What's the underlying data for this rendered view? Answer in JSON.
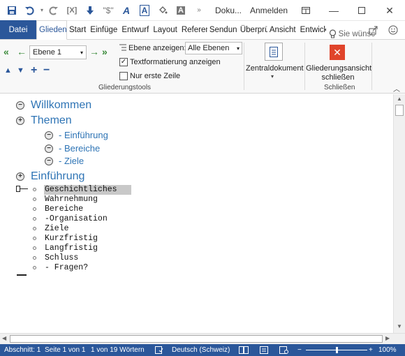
{
  "titlebar": {
    "title": "Doku...",
    "signin": "Anmelden",
    "qat_icons": [
      "save-icon",
      "undo-icon",
      "redo-icon",
      "field-code-icon",
      "down-arrow-icon",
      "variable-icon",
      "text-effect-icon",
      "framed-a-icon",
      "paint-bucket-icon",
      "shaded-a-icon",
      "more-icon"
    ]
  },
  "tabs": [
    "Datei",
    "Glieden",
    "Start",
    "Einfüge",
    "Entwurf",
    "Layout",
    "Referen",
    "Sendun",
    "Überprü",
    "Ansicht",
    "Entwick"
  ],
  "tellme": "Sie wünsc",
  "ribbon": {
    "outline_level_value": "Ebene 1",
    "show_level_label": "Ebene anzeigen:",
    "show_level_value": "Alle Ebenen",
    "text_formatting_label": "Textformatierung anzeigen",
    "first_line_label": "Nur erste Zeile",
    "group_outline_tools": "Gliederungstools",
    "master_document_label": "Zentraldokument",
    "close_outline_label_1": "Gliederungsansicht",
    "close_outline_label_2": "schließen",
    "group_close": "Schließen",
    "text_formatting_checked": true,
    "first_line_checked": false
  },
  "document": {
    "heading_welcome": "Willkommen",
    "heading_topics": "Themen",
    "sub_1": "- Einführung",
    "sub_2": "- Bereiche",
    "sub_3": "- Ziele",
    "heading_intro": "Einführung",
    "body": [
      "Geschichtliches",
      "Wahrnehmung",
      "Bereiche",
      "-Organisation",
      "Ziele",
      "Kurzfristig",
      "Langfristig",
      "Schluss",
      "- Fragen?"
    ]
  },
  "status": {
    "section": "Abschnitt: 1",
    "page": "Seite 1 von 1",
    "words": "1 von 19 Wörtern",
    "language": "Deutsch (Schweiz)",
    "zoom": "100%",
    "zoom_level": 1.0
  },
  "colors": {
    "accent": "#2b579a",
    "heading": "#2e74b5",
    "close_red": "#e0442b"
  }
}
